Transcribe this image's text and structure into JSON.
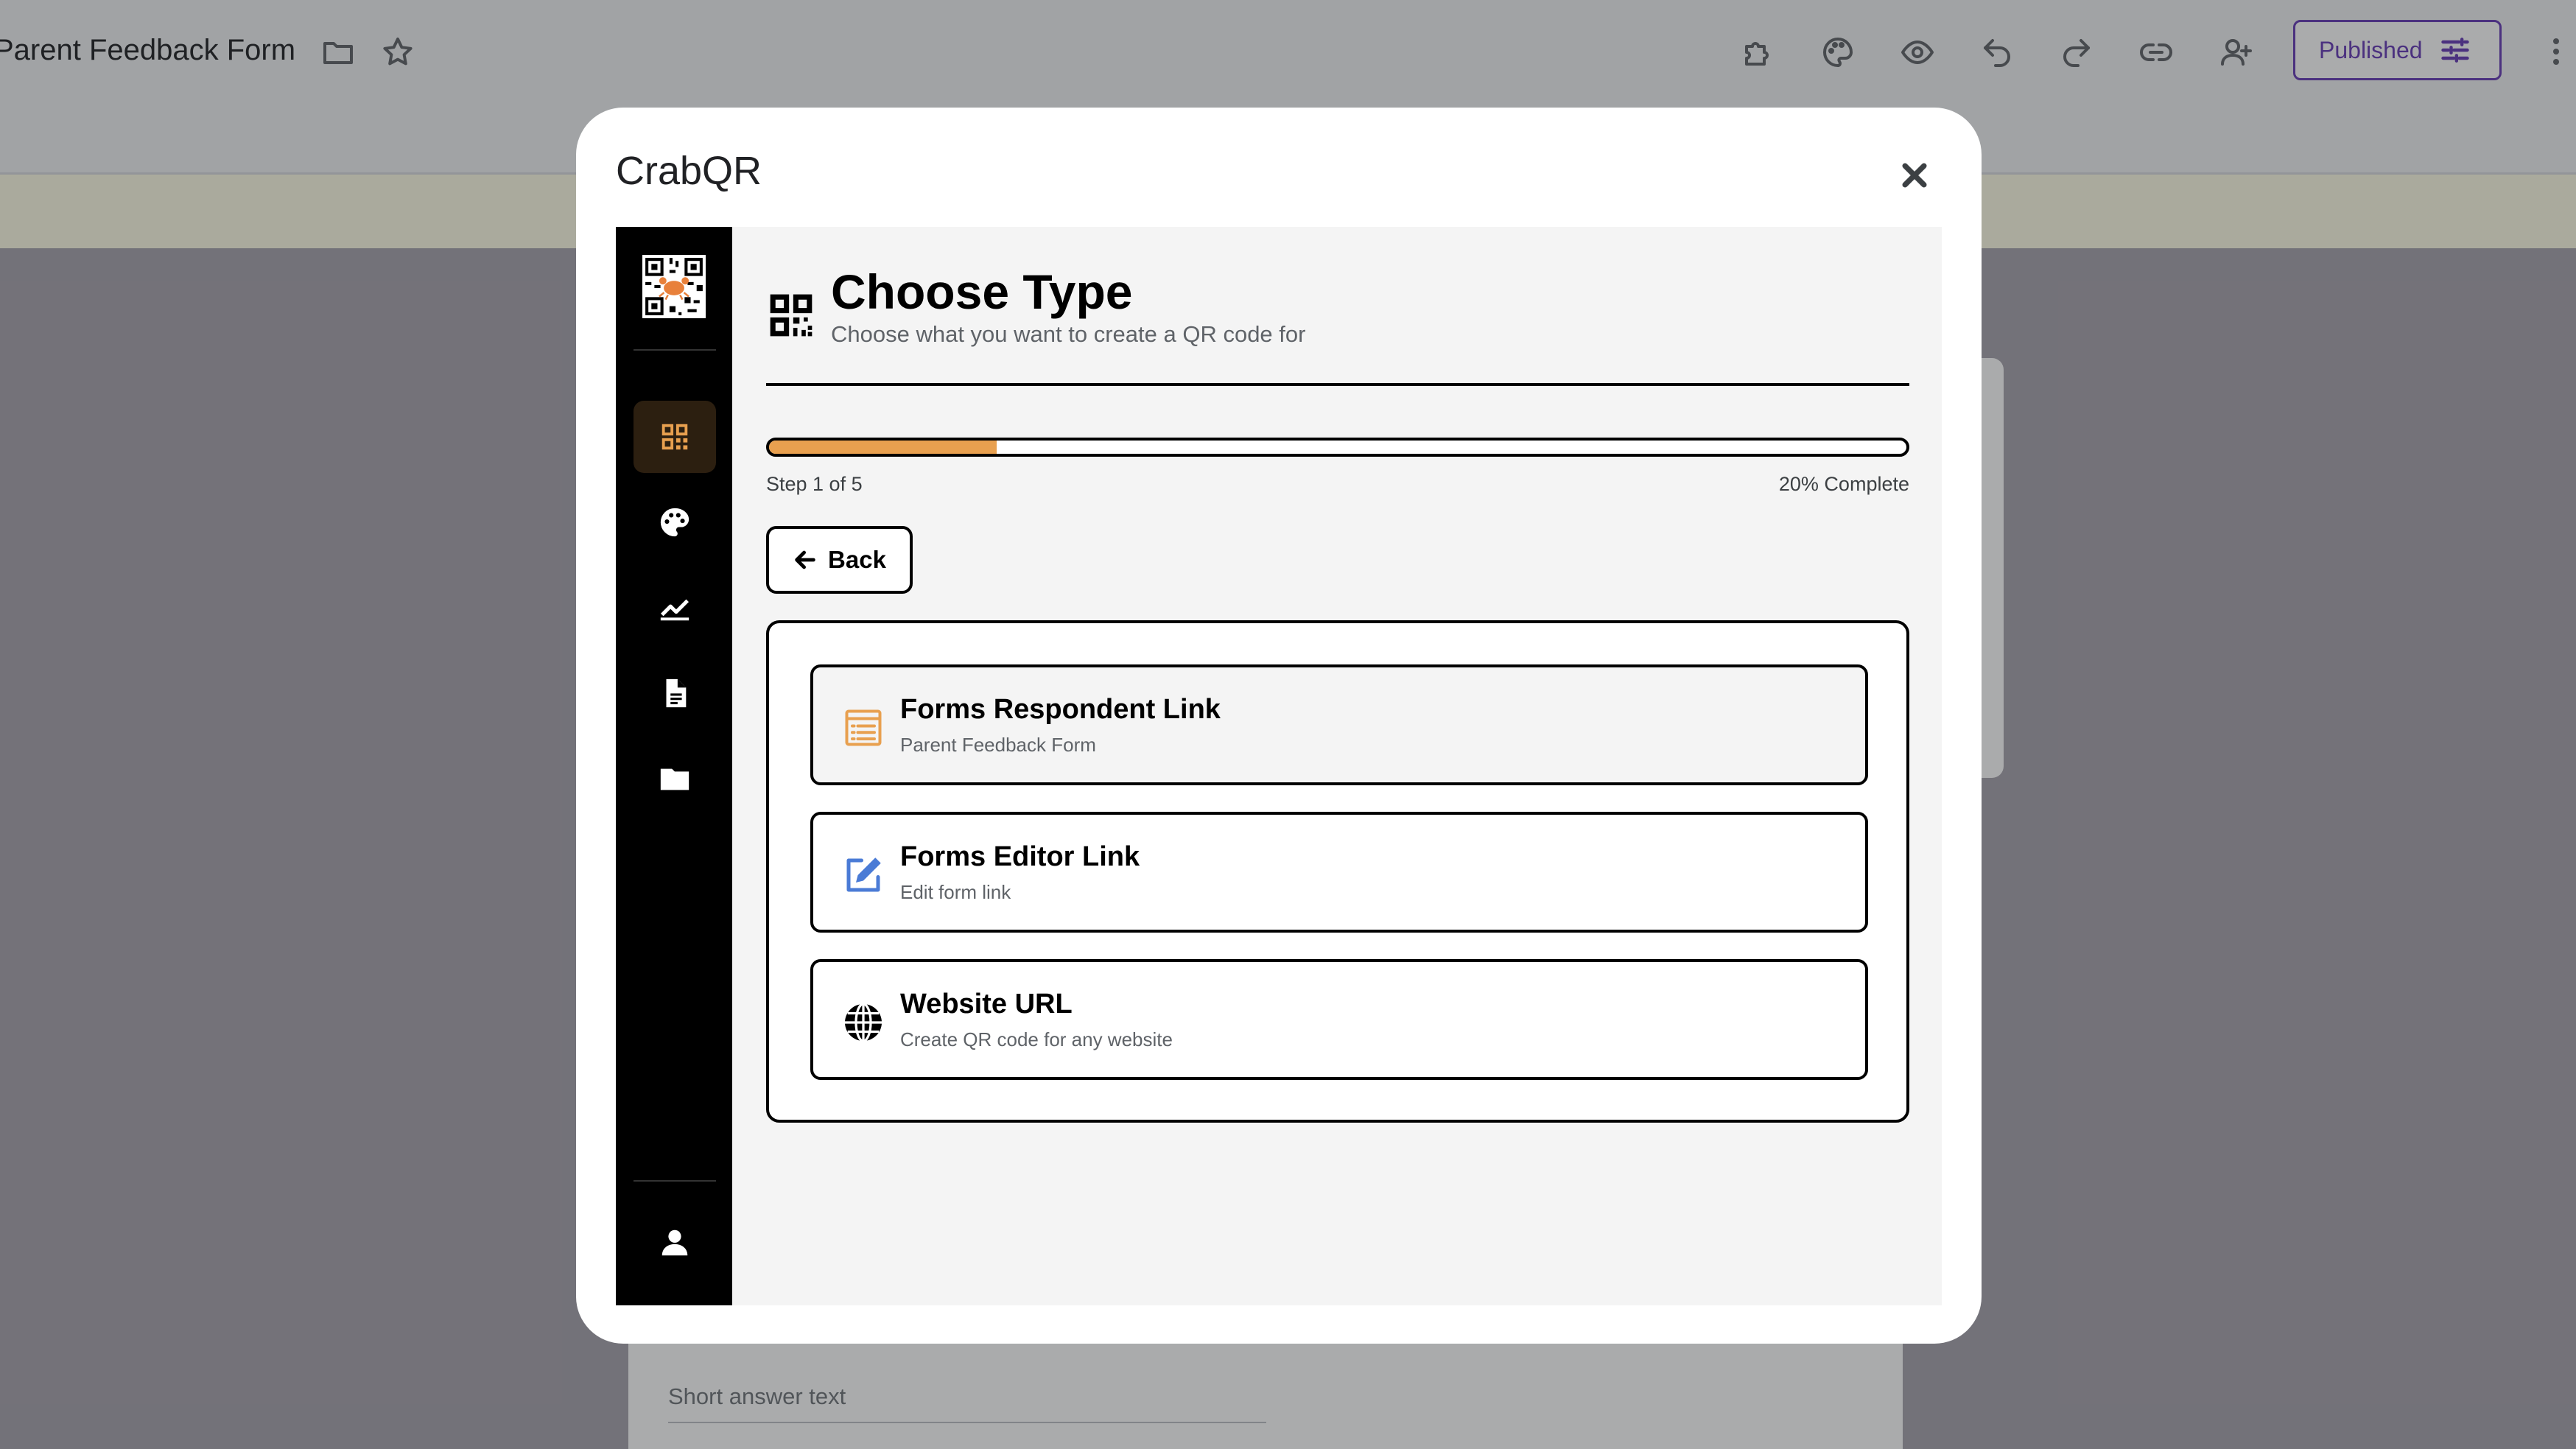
{
  "background": {
    "form_title": "Parent Feedback Form",
    "published_label": "Published",
    "short_answer_placeholder": "Short answer text"
  },
  "modal": {
    "title": "CrabQR"
  },
  "sidebar": {
    "items": [
      {
        "name": "qr-code-icon",
        "active": true
      },
      {
        "name": "palette-icon",
        "active": false
      },
      {
        "name": "analytics-icon",
        "active": false
      },
      {
        "name": "document-icon",
        "active": false
      },
      {
        "name": "folder-icon",
        "active": false
      }
    ],
    "bottom_item": "person-icon"
  },
  "header": {
    "title": "Choose Type",
    "subtitle": "Choose what you want to create a QR code for"
  },
  "progress": {
    "step_text": "Step 1 of 5",
    "percent_text": "20% Complete",
    "fraction": 0.2
  },
  "back_label": "Back",
  "options": [
    {
      "title": "Forms Respondent Link",
      "subtitle": "Parent Feedback Form",
      "icon": "form-icon",
      "selected": true
    },
    {
      "title": "Forms Editor Link",
      "subtitle": "Edit form link",
      "icon": "edit-icon",
      "selected": false
    },
    {
      "title": "Website URL",
      "subtitle": "Create QR code for any website",
      "icon": "globe-icon",
      "selected": false
    }
  ],
  "colors": {
    "accent": "#e8a04f",
    "sidebar_bg": "#000000",
    "edit_icon": "#4a7bd6",
    "published": "#673ab7"
  }
}
